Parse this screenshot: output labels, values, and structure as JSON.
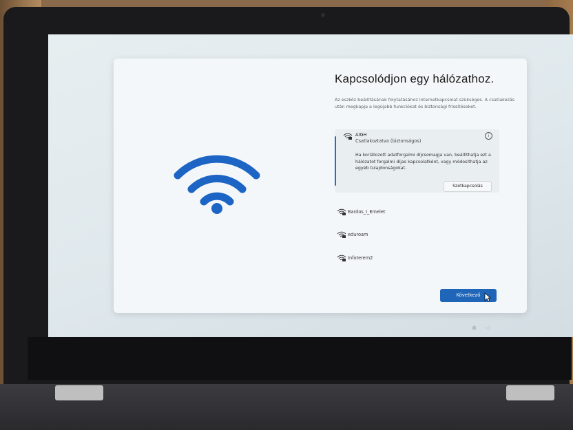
{
  "setup": {
    "title": "Kapcsolódjon egy hálózathoz.",
    "subtitle": "Az eszköz beállításának folytatásához internetkapcsolat szükséges. A csatlakozás után megkapja a legújabb funkciókat és biztonsági frissítéseket.",
    "selected_network": {
      "name": "AIGH",
      "status": "Csatlakoztatva (biztonságos)",
      "info_glyph": "i",
      "description": "Ha korlátozott adatforgalmi díjcsomagja van, beállíthatja ezt a hálózatot forgalmi díjas kapcsolatként, vagy módosíthatja az egyéb tulajdonságokat.",
      "disconnect_label": "Szétkapcsolás"
    },
    "networks": [
      {
        "name": "Bardos_I_Emelet"
      },
      {
        "name": "eduroam"
      },
      {
        "name": "Infoterem2"
      }
    ],
    "next_label": "Következő"
  },
  "colors": {
    "accent": "#1f66b8",
    "wifi_art": "#1c65c4"
  }
}
